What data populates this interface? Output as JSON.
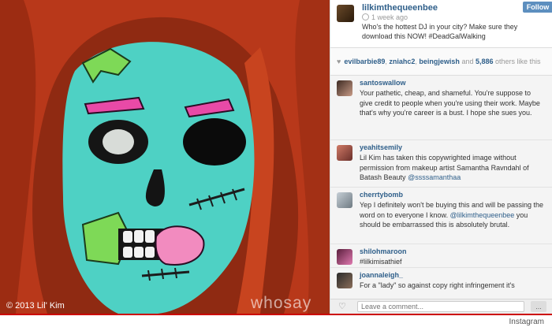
{
  "photo": {
    "credit": "© 2013 Lil' Kim",
    "watermark": "whosay"
  },
  "post": {
    "username": "lilkimthequeenbee",
    "time": "1 week ago",
    "caption": "Who's the hottest DJ in your city? Make sure they download this NOW! #DeadGalWalking",
    "follow_label": "Follow"
  },
  "likes": {
    "users": [
      "evilbarbie89",
      "zniahc2",
      "beingjewish"
    ],
    "others": "5,886",
    "others_suffix": "others like this"
  },
  "comments": [
    {
      "user": "santoswallow",
      "text": "Your pathetic, cheap, and shameful. You're suppose to give credit to people when you're using their work. Maybe that's why you're career is a bust. I hope she sues you.",
      "mention": ""
    },
    {
      "user": "yeahitsemily",
      "text": "Lil Kim has taken this copywrighted image without permission from makeup artist Samantha Ravndahl of Batash Beauty",
      "mention": "@ssssamanthaa"
    },
    {
      "user": "cherrtybomb",
      "text": "Yep I definitely won't be buying this and will be passing the word on to everyone I know.",
      "mention": "@lilkimthequeenbee",
      "after": "you should be embarrassed this is absolutely brutal."
    },
    {
      "user": "shilohmaroon",
      "text": "#lilkimisathief",
      "mention": ""
    },
    {
      "user": "joannaleigh_",
      "text": "For a \"lady\" so against copy right infringement it's",
      "mention": ""
    }
  ],
  "comment_bar": {
    "placeholder": "Leave a comment...",
    "more_label": "..."
  },
  "footer": {
    "source": "Instagram"
  },
  "colors": {
    "username": "#2f5f8a",
    "follow_button": "#5d8fbf",
    "bottom_rule": "#cc0000",
    "face_paint": "#4ed1c4",
    "hair": "#b8381a"
  }
}
